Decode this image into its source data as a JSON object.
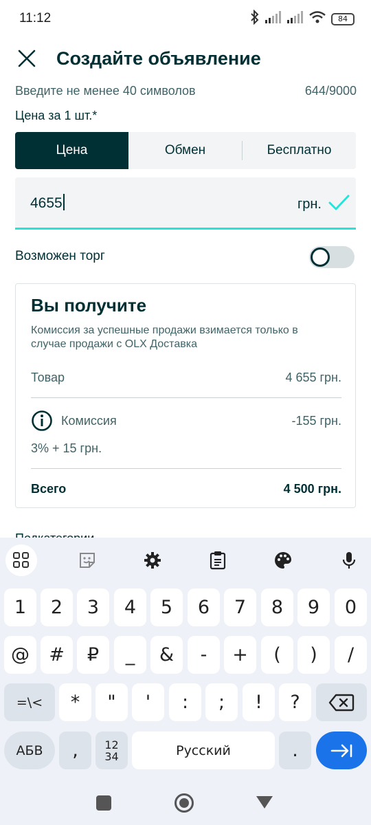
{
  "status_bar": {
    "time": "11:12",
    "battery": "84"
  },
  "header": {
    "title": "Создайте объявление"
  },
  "description_hint": {
    "text": "Введите не менее 40 символов",
    "counter": "644/9000"
  },
  "price_label": "Цена за 1 шт.*",
  "price_type_tabs": [
    {
      "label": "Цена",
      "selected": true
    },
    {
      "label": "Обмен",
      "selected": false
    },
    {
      "label": "Бесплатно",
      "selected": false
    }
  ],
  "price_input": {
    "value": "4655",
    "currency": "грн."
  },
  "negotiable": {
    "label": "Возможен торг",
    "enabled": false
  },
  "summary": {
    "title": "Вы получите",
    "description": "Комиссия за успешные продажи взимается только в случае продажи с OLX Доставка",
    "item_label": "Товар",
    "item_value": "4 655 грн.",
    "commission_label": "Комиссия",
    "commission_value": "-155 грн.",
    "commission_detail": "3% + 15 грн.",
    "total_label": "Всего",
    "total_value": "4 500 грн."
  },
  "subcategories_label": "Подкатегории",
  "keyboard": {
    "row1": [
      "1",
      "2",
      "3",
      "4",
      "5",
      "6",
      "7",
      "8",
      "9",
      "0"
    ],
    "row2": [
      "@",
      "#",
      "₽",
      "_",
      "&",
      "-",
      "+",
      "(",
      ")",
      "/"
    ],
    "row3_symbols": [
      "*",
      "\"",
      "'",
      ":",
      ";",
      "!",
      "?"
    ],
    "mode_key": "=\\<",
    "abc_key": "АБВ",
    "comma_key": ",",
    "numpad_key": "12\n34",
    "numpad_top": "12",
    "numpad_bottom": "34",
    "space_label": "Русский",
    "period_key": "."
  },
  "colors": {
    "primary": "#002f34",
    "accent": "#23e5db",
    "enter_key": "#1a73e8"
  }
}
